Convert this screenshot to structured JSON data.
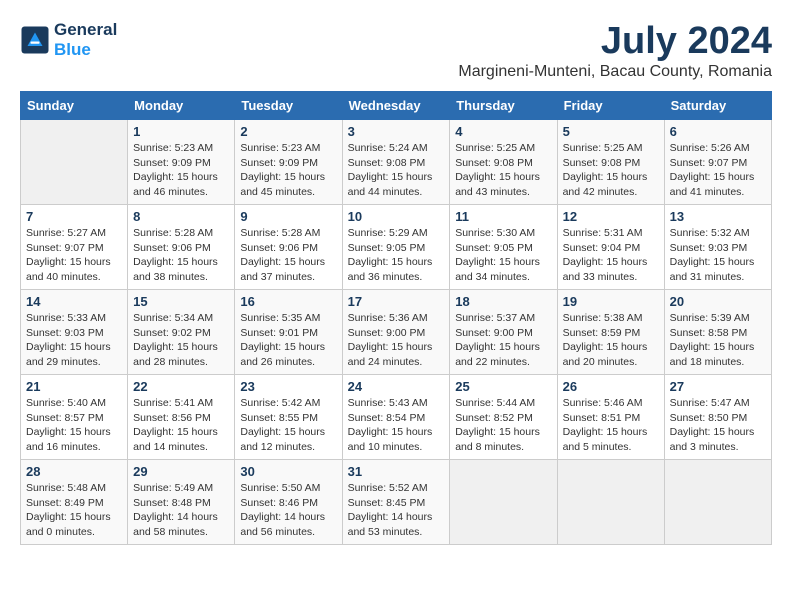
{
  "logo": {
    "line1": "General",
    "line2": "Blue"
  },
  "title": "July 2024",
  "location": "Margineni-Munteni, Bacau County, Romania",
  "weekdays": [
    "Sunday",
    "Monday",
    "Tuesday",
    "Wednesday",
    "Thursday",
    "Friday",
    "Saturday"
  ],
  "weeks": [
    [
      {
        "day": "",
        "info": ""
      },
      {
        "day": "1",
        "info": "Sunrise: 5:23 AM\nSunset: 9:09 PM\nDaylight: 15 hours\nand 46 minutes."
      },
      {
        "day": "2",
        "info": "Sunrise: 5:23 AM\nSunset: 9:09 PM\nDaylight: 15 hours\nand 45 minutes."
      },
      {
        "day": "3",
        "info": "Sunrise: 5:24 AM\nSunset: 9:08 PM\nDaylight: 15 hours\nand 44 minutes."
      },
      {
        "day": "4",
        "info": "Sunrise: 5:25 AM\nSunset: 9:08 PM\nDaylight: 15 hours\nand 43 minutes."
      },
      {
        "day": "5",
        "info": "Sunrise: 5:25 AM\nSunset: 9:08 PM\nDaylight: 15 hours\nand 42 minutes."
      },
      {
        "day": "6",
        "info": "Sunrise: 5:26 AM\nSunset: 9:07 PM\nDaylight: 15 hours\nand 41 minutes."
      }
    ],
    [
      {
        "day": "7",
        "info": "Sunrise: 5:27 AM\nSunset: 9:07 PM\nDaylight: 15 hours\nand 40 minutes."
      },
      {
        "day": "8",
        "info": "Sunrise: 5:28 AM\nSunset: 9:06 PM\nDaylight: 15 hours\nand 38 minutes."
      },
      {
        "day": "9",
        "info": "Sunrise: 5:28 AM\nSunset: 9:06 PM\nDaylight: 15 hours\nand 37 minutes."
      },
      {
        "day": "10",
        "info": "Sunrise: 5:29 AM\nSunset: 9:05 PM\nDaylight: 15 hours\nand 36 minutes."
      },
      {
        "day": "11",
        "info": "Sunrise: 5:30 AM\nSunset: 9:05 PM\nDaylight: 15 hours\nand 34 minutes."
      },
      {
        "day": "12",
        "info": "Sunrise: 5:31 AM\nSunset: 9:04 PM\nDaylight: 15 hours\nand 33 minutes."
      },
      {
        "day": "13",
        "info": "Sunrise: 5:32 AM\nSunset: 9:03 PM\nDaylight: 15 hours\nand 31 minutes."
      }
    ],
    [
      {
        "day": "14",
        "info": "Sunrise: 5:33 AM\nSunset: 9:03 PM\nDaylight: 15 hours\nand 29 minutes."
      },
      {
        "day": "15",
        "info": "Sunrise: 5:34 AM\nSunset: 9:02 PM\nDaylight: 15 hours\nand 28 minutes."
      },
      {
        "day": "16",
        "info": "Sunrise: 5:35 AM\nSunset: 9:01 PM\nDaylight: 15 hours\nand 26 minutes."
      },
      {
        "day": "17",
        "info": "Sunrise: 5:36 AM\nSunset: 9:00 PM\nDaylight: 15 hours\nand 24 minutes."
      },
      {
        "day": "18",
        "info": "Sunrise: 5:37 AM\nSunset: 9:00 PM\nDaylight: 15 hours\nand 22 minutes."
      },
      {
        "day": "19",
        "info": "Sunrise: 5:38 AM\nSunset: 8:59 PM\nDaylight: 15 hours\nand 20 minutes."
      },
      {
        "day": "20",
        "info": "Sunrise: 5:39 AM\nSunset: 8:58 PM\nDaylight: 15 hours\nand 18 minutes."
      }
    ],
    [
      {
        "day": "21",
        "info": "Sunrise: 5:40 AM\nSunset: 8:57 PM\nDaylight: 15 hours\nand 16 minutes."
      },
      {
        "day": "22",
        "info": "Sunrise: 5:41 AM\nSunset: 8:56 PM\nDaylight: 15 hours\nand 14 minutes."
      },
      {
        "day": "23",
        "info": "Sunrise: 5:42 AM\nSunset: 8:55 PM\nDaylight: 15 hours\nand 12 minutes."
      },
      {
        "day": "24",
        "info": "Sunrise: 5:43 AM\nSunset: 8:54 PM\nDaylight: 15 hours\nand 10 minutes."
      },
      {
        "day": "25",
        "info": "Sunrise: 5:44 AM\nSunset: 8:52 PM\nDaylight: 15 hours\nand 8 minutes."
      },
      {
        "day": "26",
        "info": "Sunrise: 5:46 AM\nSunset: 8:51 PM\nDaylight: 15 hours\nand 5 minutes."
      },
      {
        "day": "27",
        "info": "Sunrise: 5:47 AM\nSunset: 8:50 PM\nDaylight: 15 hours\nand 3 minutes."
      }
    ],
    [
      {
        "day": "28",
        "info": "Sunrise: 5:48 AM\nSunset: 8:49 PM\nDaylight: 15 hours\nand 0 minutes."
      },
      {
        "day": "29",
        "info": "Sunrise: 5:49 AM\nSunset: 8:48 PM\nDaylight: 14 hours\nand 58 minutes."
      },
      {
        "day": "30",
        "info": "Sunrise: 5:50 AM\nSunset: 8:46 PM\nDaylight: 14 hours\nand 56 minutes."
      },
      {
        "day": "31",
        "info": "Sunrise: 5:52 AM\nSunset: 8:45 PM\nDaylight: 14 hours\nand 53 minutes."
      },
      {
        "day": "",
        "info": ""
      },
      {
        "day": "",
        "info": ""
      },
      {
        "day": "",
        "info": ""
      }
    ]
  ]
}
